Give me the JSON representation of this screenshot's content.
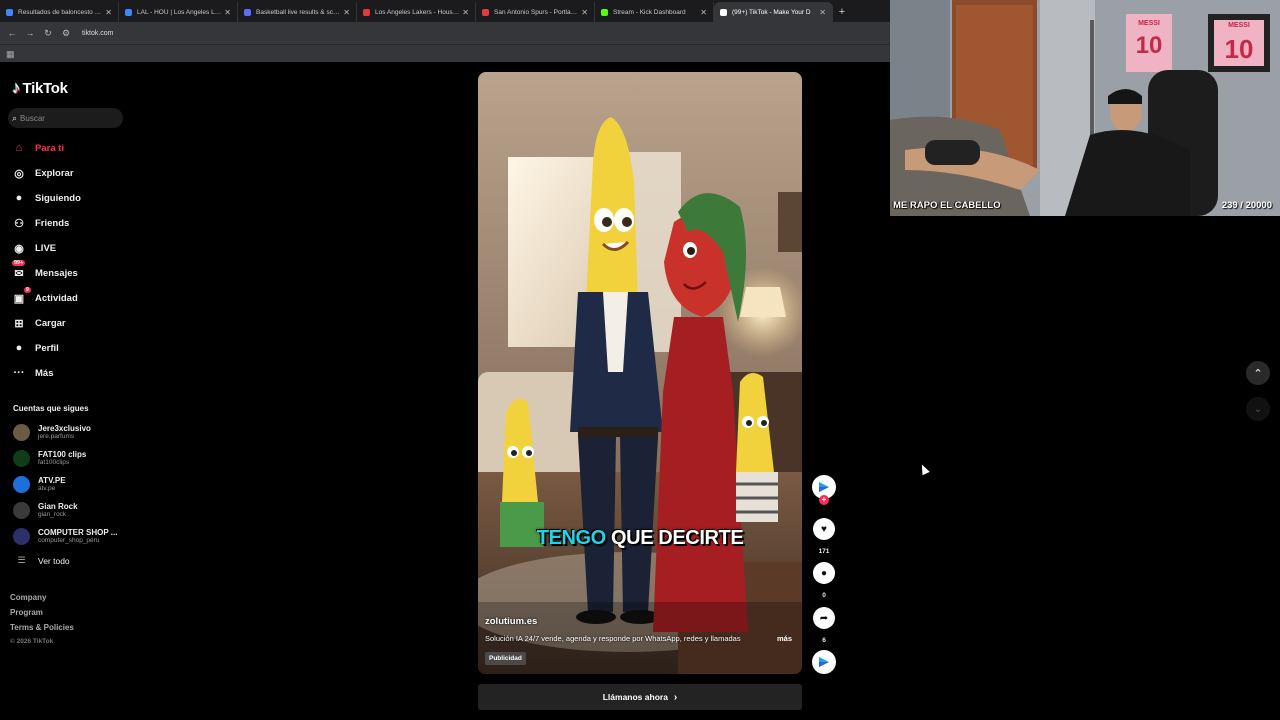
{
  "browser": {
    "tabs": [
      {
        "title": "Resultados de baloncesto en v",
        "favicon": "google-icon",
        "color": "#4285f4"
      },
      {
        "title": "LAL - HOU | Los Angeles Laker",
        "favicon": "google-icon",
        "color": "#4285f4"
      },
      {
        "title": "Basketball live results & schedu",
        "favicon": "flashscore-icon",
        "color": "#5b6ef5"
      },
      {
        "title": "Los Angeles Lakers - Houston R",
        "favicon": "flashscore-icon",
        "color": "#e23b3b"
      },
      {
        "title": "San Antonio Spurs - Portland T",
        "favicon": "flashscore-icon",
        "color": "#e23b3b"
      },
      {
        "title": "Stream - Kick Dashboard",
        "favicon": "kick-icon",
        "color": "#53fc18"
      },
      {
        "title": "(99+) TikTok - Make Your D",
        "favicon": "tiktok-icon",
        "color": "#ffffff"
      }
    ],
    "url": "tiktok.com"
  },
  "sidebar": {
    "logo": "TikTok",
    "search_placeholder": "Buscar",
    "nav": [
      {
        "label": "Para ti",
        "icon": "home-icon",
        "active": true
      },
      {
        "label": "Explorar",
        "icon": "compass-icon"
      },
      {
        "label": "Siguiendo",
        "icon": "following-avatar-icon"
      },
      {
        "label": "Friends",
        "icon": "friends-icon"
      },
      {
        "label": "LIVE",
        "icon": "live-icon"
      },
      {
        "label": "Mensajes",
        "icon": "messages-icon",
        "badge": "99+"
      },
      {
        "label": "Actividad",
        "icon": "activity-icon",
        "badge": "9"
      },
      {
        "label": "Cargar",
        "icon": "upload-icon"
      },
      {
        "label": "Perfil",
        "icon": "profile-icon"
      },
      {
        "label": "Más",
        "icon": "more-icon"
      }
    ],
    "following_title": "Cuentas que sigues",
    "accounts": [
      {
        "name": "Jere3xclusivo",
        "handle": "jere.parfums",
        "color": "#6b5a44"
      },
      {
        "name": "FAT100 clips",
        "handle": "fat100clips",
        "color": "#0f3d18"
      },
      {
        "name": "ATV.PE",
        "handle": "atv.pe",
        "color": "#1e6fd9"
      },
      {
        "name": "Gian Rock",
        "handle": "gian_rock",
        "color": "#3a3a3a"
      },
      {
        "name": "COMPUTER SHOP ...",
        "handle": "computer_shop_peru",
        "color": "#2b2f6b"
      }
    ],
    "see_all": "Ver todo",
    "footer": [
      "Company",
      "Program",
      "Terms & Policies"
    ],
    "copyright": "© 2026 TikTok"
  },
  "video": {
    "caption_highlight": "TENGO",
    "caption_rest": " QUE DECIRTE",
    "author": "zolutium.es",
    "description": "Solución IA 24/7 vende, agenda y responde por WhatsApp, redes y llamadas",
    "more": "más",
    "tag": "Publicidad",
    "cta": "Llámanos ahora"
  },
  "actions": {
    "likes": "171",
    "comments": "0",
    "shares": "6"
  },
  "stream": {
    "title": "ME RAPO EL CABELLO",
    "counter": "239 / 20000",
    "jersey_name": "MESSI",
    "jersey_number": "10"
  }
}
